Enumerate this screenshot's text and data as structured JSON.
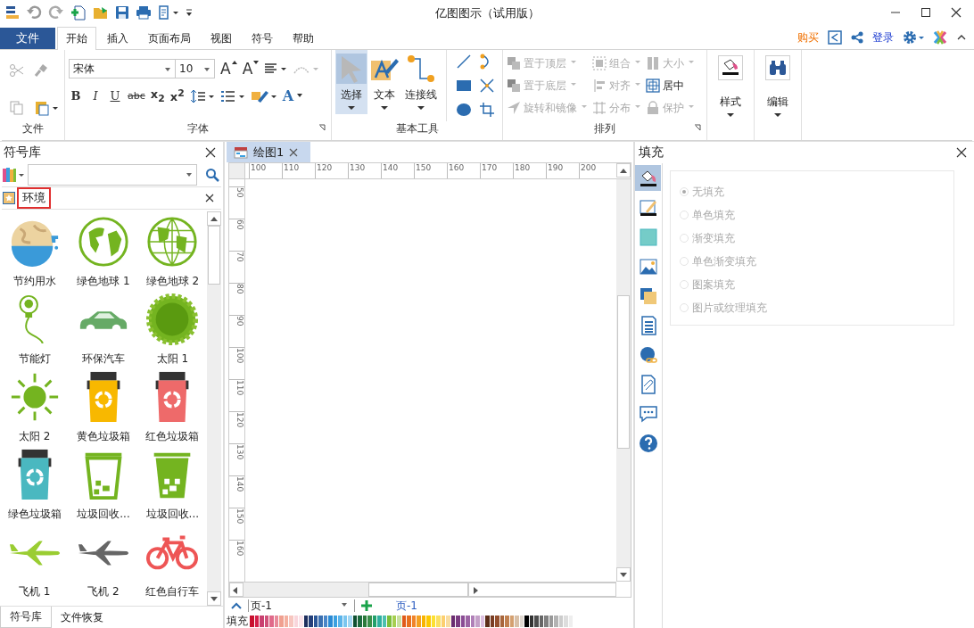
{
  "window": {
    "title": "亿图图示（试用版）"
  },
  "menu_tabs": [
    {
      "label": "文件",
      "kind": "file",
      "selected": false
    },
    {
      "label": "开始",
      "kind": "tab",
      "selected": true
    },
    {
      "label": "插入",
      "kind": "tab",
      "selected": false
    },
    {
      "label": "页面布局",
      "kind": "tab",
      "selected": false
    },
    {
      "label": "视图",
      "kind": "tab",
      "selected": false
    },
    {
      "label": "符号",
      "kind": "tab",
      "selected": false
    },
    {
      "label": "帮助",
      "kind": "tab",
      "selected": false
    }
  ],
  "account": {
    "buy": "购买",
    "login": "登录"
  },
  "ribbon": {
    "file_group": {
      "label": "文件"
    },
    "font_group": {
      "label": "字体",
      "font": "宋体",
      "size": "10",
      "size_buttons": [
        {
          "label": "A",
          "kind": "grow"
        },
        {
          "label": "A",
          "kind": "shrink"
        }
      ],
      "format_buttons": [
        {
          "label": "B",
          "kind": "bold"
        },
        {
          "label": "I",
          "kind": "italic"
        },
        {
          "label": "U",
          "kind": "underline"
        },
        {
          "label": "abc",
          "kind": "strike"
        },
        {
          "label": "x$_{2}$",
          "kind": "sub"
        },
        {
          "label": "x$^{2}$",
          "kind": "sup"
        }
      ],
      "font_color": "A"
    },
    "tools_group": {
      "label": "基本工具",
      "tools": [
        {
          "label": "选择",
          "kind": "pointer",
          "selected": true
        },
        {
          "label": "文本",
          "kind": "text",
          "selected": false
        },
        {
          "label": "连接线",
          "kind": "connector",
          "selected": false
        }
      ]
    },
    "arrange_group": {
      "label": "排列",
      "columns": [
        [
          {
            "label": "置于顶层",
            "kind": "front",
            "disabled": true
          },
          {
            "label": "置于底层",
            "kind": "back",
            "disabled": true
          },
          {
            "label": "旋转和镜像",
            "kind": "rotate",
            "disabled": true
          }
        ],
        [
          {
            "label": "组合",
            "kind": "group",
            "disabled": true
          },
          {
            "label": "对齐",
            "kind": "align",
            "disabled": true
          },
          {
            "label": "分布",
            "kind": "distribute",
            "disabled": true
          }
        ],
        [
          {
            "label": "大小",
            "kind": "size",
            "disabled": true
          },
          {
            "label": "居中",
            "kind": "center",
            "disabled": false
          },
          {
            "label": "保护",
            "kind": "lock",
            "disabled": true
          }
        ]
      ]
    },
    "big_buttons": [
      {
        "label": "样式",
        "kind": "style"
      },
      {
        "label": "编辑",
        "kind": "edit"
      }
    ]
  },
  "symbol_library": {
    "title": "符号库",
    "category": "环境",
    "symbols": [
      {
        "name": "节约用水",
        "kind": "globe-tap",
        "color": "#3a9ad9"
      },
      {
        "name": "绿色地球 1",
        "kind": "globe",
        "color": "#74b420"
      },
      {
        "name": "绿色地球 2",
        "kind": "globe-grid",
        "color": "#74b420"
      },
      {
        "name": "节能灯",
        "kind": "bulb",
        "color": "#74b420"
      },
      {
        "name": "环保汽车",
        "kind": "car",
        "color": "#66aa66"
      },
      {
        "name": "太阳 1",
        "kind": "sun-jagged",
        "color": "#74b420"
      },
      {
        "name": "太阳 2",
        "kind": "sun",
        "color": "#74b420"
      },
      {
        "name": "黄色垃圾箱",
        "kind": "bin",
        "color": "#f8b800"
      },
      {
        "name": "红色垃圾箱",
        "kind": "bin",
        "color": "#ee6a6a"
      },
      {
        "name": "绿色垃圾箱",
        "kind": "bin",
        "color": "#4ab8c0"
      },
      {
        "name": "垃圾回收...",
        "kind": "bin-outline",
        "color": "#74b420"
      },
      {
        "name": "垃圾回收...",
        "kind": "bin-solid",
        "color": "#74b420"
      },
      {
        "name": "飞机 1",
        "kind": "plane",
        "color": "#9acd32"
      },
      {
        "name": "飞机 2",
        "kind": "plane",
        "color": "#666666"
      },
      {
        "name": "红色自行车",
        "kind": "bicycle",
        "color": "#ee5555"
      }
    ],
    "bottom_tabs": [
      {
        "label": "符号库",
        "selected": true
      },
      {
        "label": "文件恢复",
        "selected": false
      }
    ]
  },
  "document": {
    "tab": "绘图1",
    "ruler": {
      "horizontal": [
        "100",
        "110",
        "120",
        "130",
        "140",
        "150",
        "160",
        "170",
        "180",
        "190",
        "200"
      ],
      "vertical": [
        "50",
        "60",
        "70",
        "80",
        "90",
        "100",
        "110",
        "120",
        "130",
        "140",
        "150",
        "160"
      ]
    },
    "page_select": "页-1",
    "page_tab": "页-1",
    "fill_label": "填充",
    "palette": [
      {
        "color": "#c8102e"
      },
      {
        "color": "#d4204a"
      },
      {
        "color": "#c94070"
      },
      {
        "color": "#d0527a"
      },
      {
        "color": "#e06a8a"
      },
      {
        "color": "#e88a9a"
      },
      {
        "color": "#f0a090"
      },
      {
        "color": "#f4b0a0"
      },
      {
        "color": "#f7c6c0"
      },
      {
        "color": "#f9d6dc"
      },
      {
        "color": "#fbe3ea"
      },
      {
        "color": "#1f2f5e"
      },
      {
        "color": "#25407a"
      },
      {
        "color": "#2b5797"
      },
      {
        "color": "#3a6fb0"
      },
      {
        "color": "#4a86c8"
      },
      {
        "color": "#2a8ad4"
      },
      {
        "color": "#3ba0e0"
      },
      {
        "color": "#5bb4ea"
      },
      {
        "color": "#7cc6ef"
      },
      {
        "color": "#a2d6f2"
      },
      {
        "color": "#0f5132"
      },
      {
        "color": "#1d6b3e"
      },
      {
        "color": "#2a7a3a"
      },
      {
        "color": "#3a8f4a"
      },
      {
        "color": "#22a06b"
      },
      {
        "color": "#30b0a0"
      },
      {
        "color": "#4cc0b0"
      },
      {
        "color": "#7cbf3a"
      },
      {
        "color": "#a6cf50"
      },
      {
        "color": "#c8e0a0"
      },
      {
        "color": "#e05a1a"
      },
      {
        "color": "#e8701e"
      },
      {
        "color": "#f0842a"
      },
      {
        "color": "#f4a020"
      },
      {
        "color": "#f8b400"
      },
      {
        "color": "#fcc800"
      },
      {
        "color": "#fde030"
      },
      {
        "color": "#fbe060"
      },
      {
        "color": "#fcd070"
      },
      {
        "color": "#f8dca0"
      },
      {
        "color": "#6a2c70"
      },
      {
        "color": "#7a3a80"
      },
      {
        "color": "#8a4c94"
      },
      {
        "color": "#9c64a4"
      },
      {
        "color": "#b080b8"
      },
      {
        "color": "#c4a0c8"
      },
      {
        "color": "#dcc0e0"
      },
      {
        "color": "#5c2e1a"
      },
      {
        "color": "#7a3e24"
      },
      {
        "color": "#94502e"
      },
      {
        "color": "#a8663c"
      },
      {
        "color": "#c08050"
      },
      {
        "color": "#d4a070"
      },
      {
        "color": "#d8c0a8"
      },
      {
        "color": "#e0d8d0"
      },
      {
        "color": "#000000"
      },
      {
        "color": "#333333"
      },
      {
        "color": "#4d4d4d"
      },
      {
        "color": "#666666"
      },
      {
        "color": "#808080"
      },
      {
        "color": "#999999"
      },
      {
        "color": "#b3b3b3"
      },
      {
        "color": "#cccccc"
      },
      {
        "color": "#dddddd"
      },
      {
        "color": "#eeeeee"
      }
    ]
  },
  "fill_panel": {
    "title": "填充",
    "side_tabs": [
      {
        "kind": "fill",
        "selected": true
      },
      {
        "kind": "line",
        "selected": false
      },
      {
        "kind": "shadow",
        "selected": false
      },
      {
        "kind": "image",
        "selected": false
      },
      {
        "kind": "layers",
        "selected": false
      },
      {
        "kind": "list",
        "selected": false
      },
      {
        "kind": "hyperlink",
        "selected": false
      },
      {
        "kind": "attachment",
        "selected": false
      },
      {
        "kind": "comment",
        "selected": false
      },
      {
        "kind": "help",
        "selected": false
      }
    ],
    "options": [
      {
        "label": "无填充",
        "selected": true
      },
      {
        "label": "单色填充",
        "selected": false
      },
      {
        "label": "渐变填充",
        "selected": false
      },
      {
        "label": "单色渐变填充",
        "selected": false
      },
      {
        "label": "图案填充",
        "selected": false
      },
      {
        "label": "图片或纹理填充",
        "selected": false
      }
    ]
  }
}
